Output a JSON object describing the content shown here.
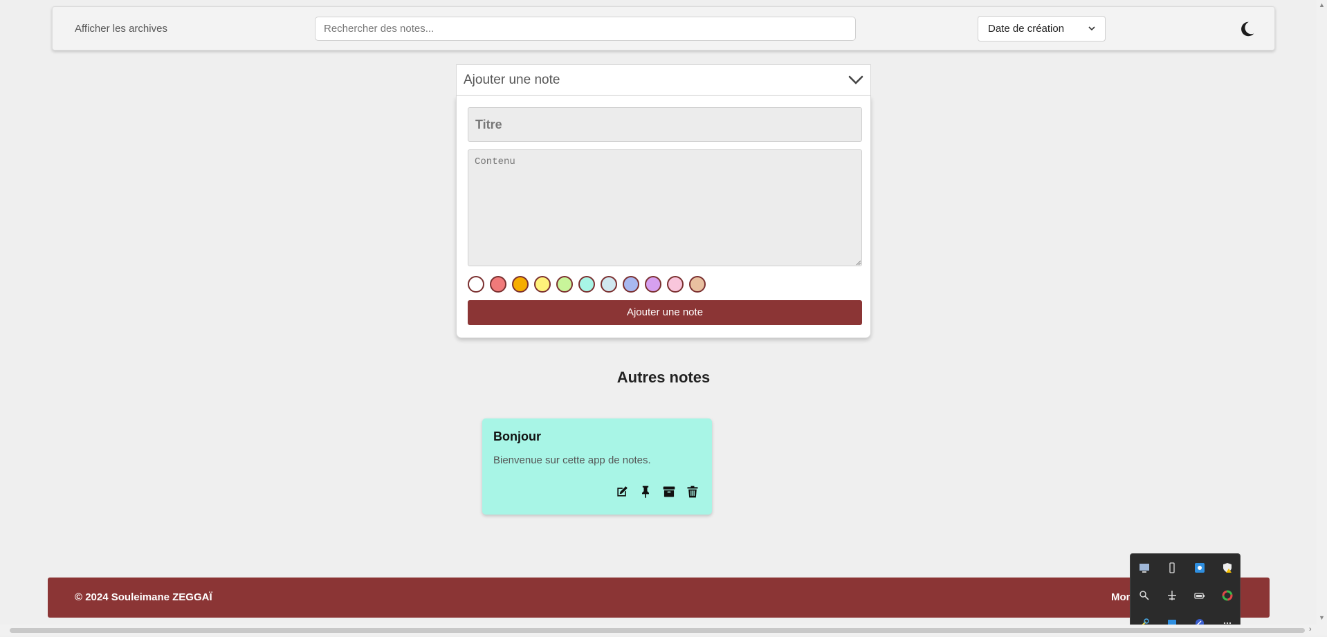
{
  "header": {
    "archives_label": "Afficher les archives",
    "search_placeholder": "Rechercher des notes...",
    "sort_selected": "Date de création",
    "theme_icon": "moon-icon"
  },
  "add_note": {
    "header_label": "Ajouter une note",
    "title_placeholder": "Titre",
    "content_placeholder": "Contenu",
    "button_label": "Ajouter une note",
    "colors": [
      "#ffffff",
      "#f07a7a",
      "#f6ad00",
      "#fff27a",
      "#c8f59a",
      "#a8f5e6",
      "#d0e8f0",
      "#a8b8f0",
      "#d6a0f0",
      "#f9c6dc",
      "#e8c0a0"
    ]
  },
  "other_notes": {
    "title": "Autres notes",
    "notes": [
      {
        "title": "Bonjour",
        "body": "Bienvenue sur cette app de notes.",
        "color": "#a8f5e6",
        "actions": [
          "edit-icon",
          "pin-icon",
          "archive-icon",
          "trash-icon"
        ]
      }
    ]
  },
  "footer": {
    "copyright": "© 2024 Souleimane ZEGGAÏ",
    "right_text": "Mon"
  },
  "tray_icons": [
    "monitor-icon",
    "usb-drive-icon",
    "network-app-icon",
    "security-warning-icon",
    "search-person-icon",
    "airplane-icon",
    "battery-icon",
    "color-wheel-icon",
    "tools-icon",
    "chat-icon",
    "browser-icon",
    "more-icon"
  ],
  "colors": {
    "accent": "#8b3535",
    "background": "#efefef",
    "note_teal": "#a8f5e6"
  }
}
